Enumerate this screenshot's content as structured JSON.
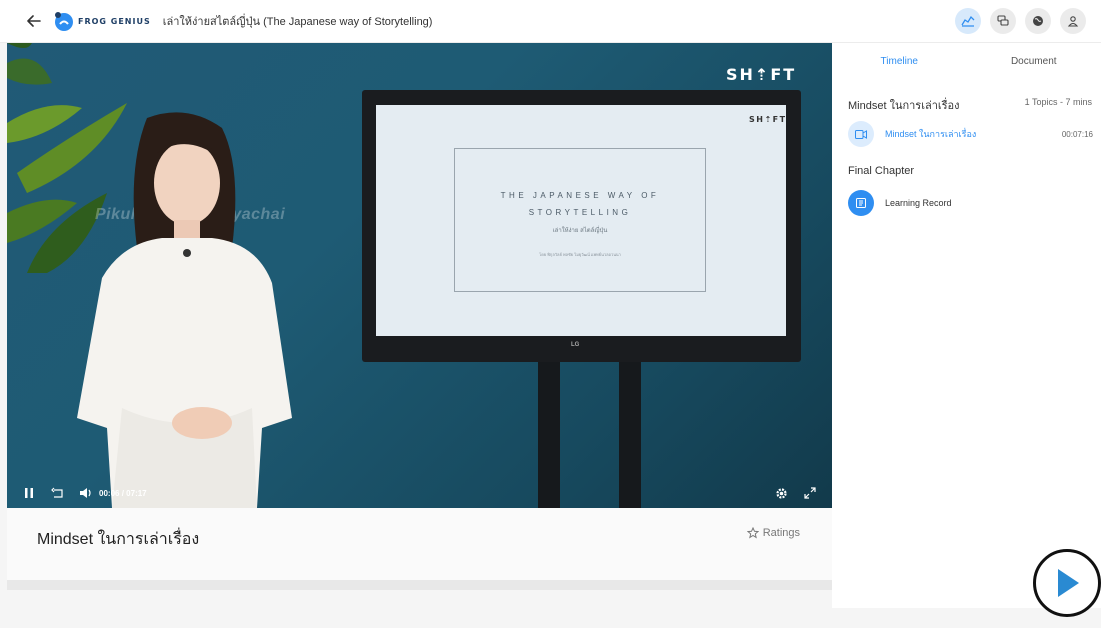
{
  "header": {
    "brand_name": "FROG GENIUS",
    "course_title": "เล่าให้ง่ายสไตล์ญี่ปุ่น (The Japanese way of Storytelling)",
    "icons": [
      "back-arrow-icon",
      "chart-icon",
      "chat-icon",
      "globe-icon",
      "user-icon"
    ]
  },
  "video": {
    "watermark": "Pikulwayako Panyachai",
    "brand": "SH⇡FT",
    "tv": {
      "brand": "SH⇡FT",
      "slide_line1": "THE JAPANESE WAY OF",
      "slide_line2": "STORYTELLING",
      "slide_line3": "เล่าให้ง่าย สไตล์ญี่ปุ่น",
      "slide_line4": "โดย พิกุลวัลย์ พลชัย ไมยุวัฒน์ แพทย์นวลอวนนา",
      "logo": "LG"
    },
    "current_time": "00:06",
    "separator": "/",
    "duration": "07:17",
    "progress": 0.014
  },
  "lesson": {
    "title": "Mindset ในการเล่าเรื่อง",
    "ratings_label": "Ratings"
  },
  "sidebar": {
    "tabs": [
      {
        "label": "Timeline",
        "active": true
      },
      {
        "label": "Document",
        "active": false
      }
    ],
    "sections": [
      {
        "title": "Mindset ในการเล่าเรื่อง",
        "meta": "1 Topics - 7 mins",
        "items": [
          {
            "label": "Mindset ในการเล่าเรื่อง",
            "duration": "00:07:16",
            "icon": "video-icon",
            "active": true
          }
        ]
      },
      {
        "title": "Final Chapter",
        "items": [
          {
            "label": "Learning Record",
            "icon": "record-icon",
            "active": false
          }
        ]
      }
    ]
  },
  "colors": {
    "accent": "#2f8ef1",
    "accent_light": "#dcecfd",
    "video_bg": "#1e5b74"
  }
}
